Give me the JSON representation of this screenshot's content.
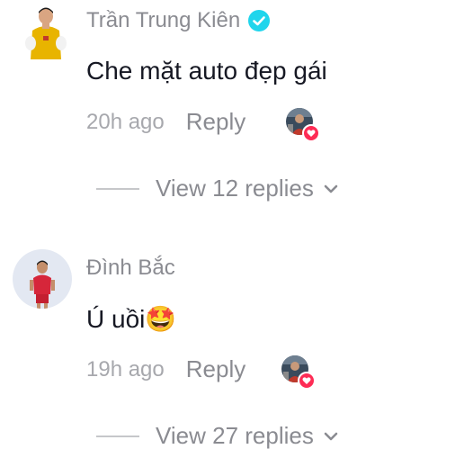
{
  "comments": [
    {
      "username": "Trần Trung Kiên",
      "verified": true,
      "text": "Che mặt auto đẹp gái",
      "time": "20h ago",
      "reply_label": "Reply",
      "view_replies_label": "View 12 replies",
      "avatar_icon": "user-avatar-yellow-kit",
      "liked_by_icon": "creator-avatar-heart-icon"
    },
    {
      "username": "Đình Bắc",
      "verified": false,
      "text": "Ú uồi🤩",
      "time": "19h ago",
      "reply_label": "Reply",
      "view_replies_label": "View 27 replies",
      "avatar_icon": "user-avatar-red-kit",
      "liked_by_icon": "creator-avatar-heart-icon"
    }
  ],
  "colors": {
    "username": "#8a8b91",
    "text": "#161823",
    "time": "#a7a8ad",
    "verified": "#20d5ec",
    "heart": "#fe2c55"
  }
}
